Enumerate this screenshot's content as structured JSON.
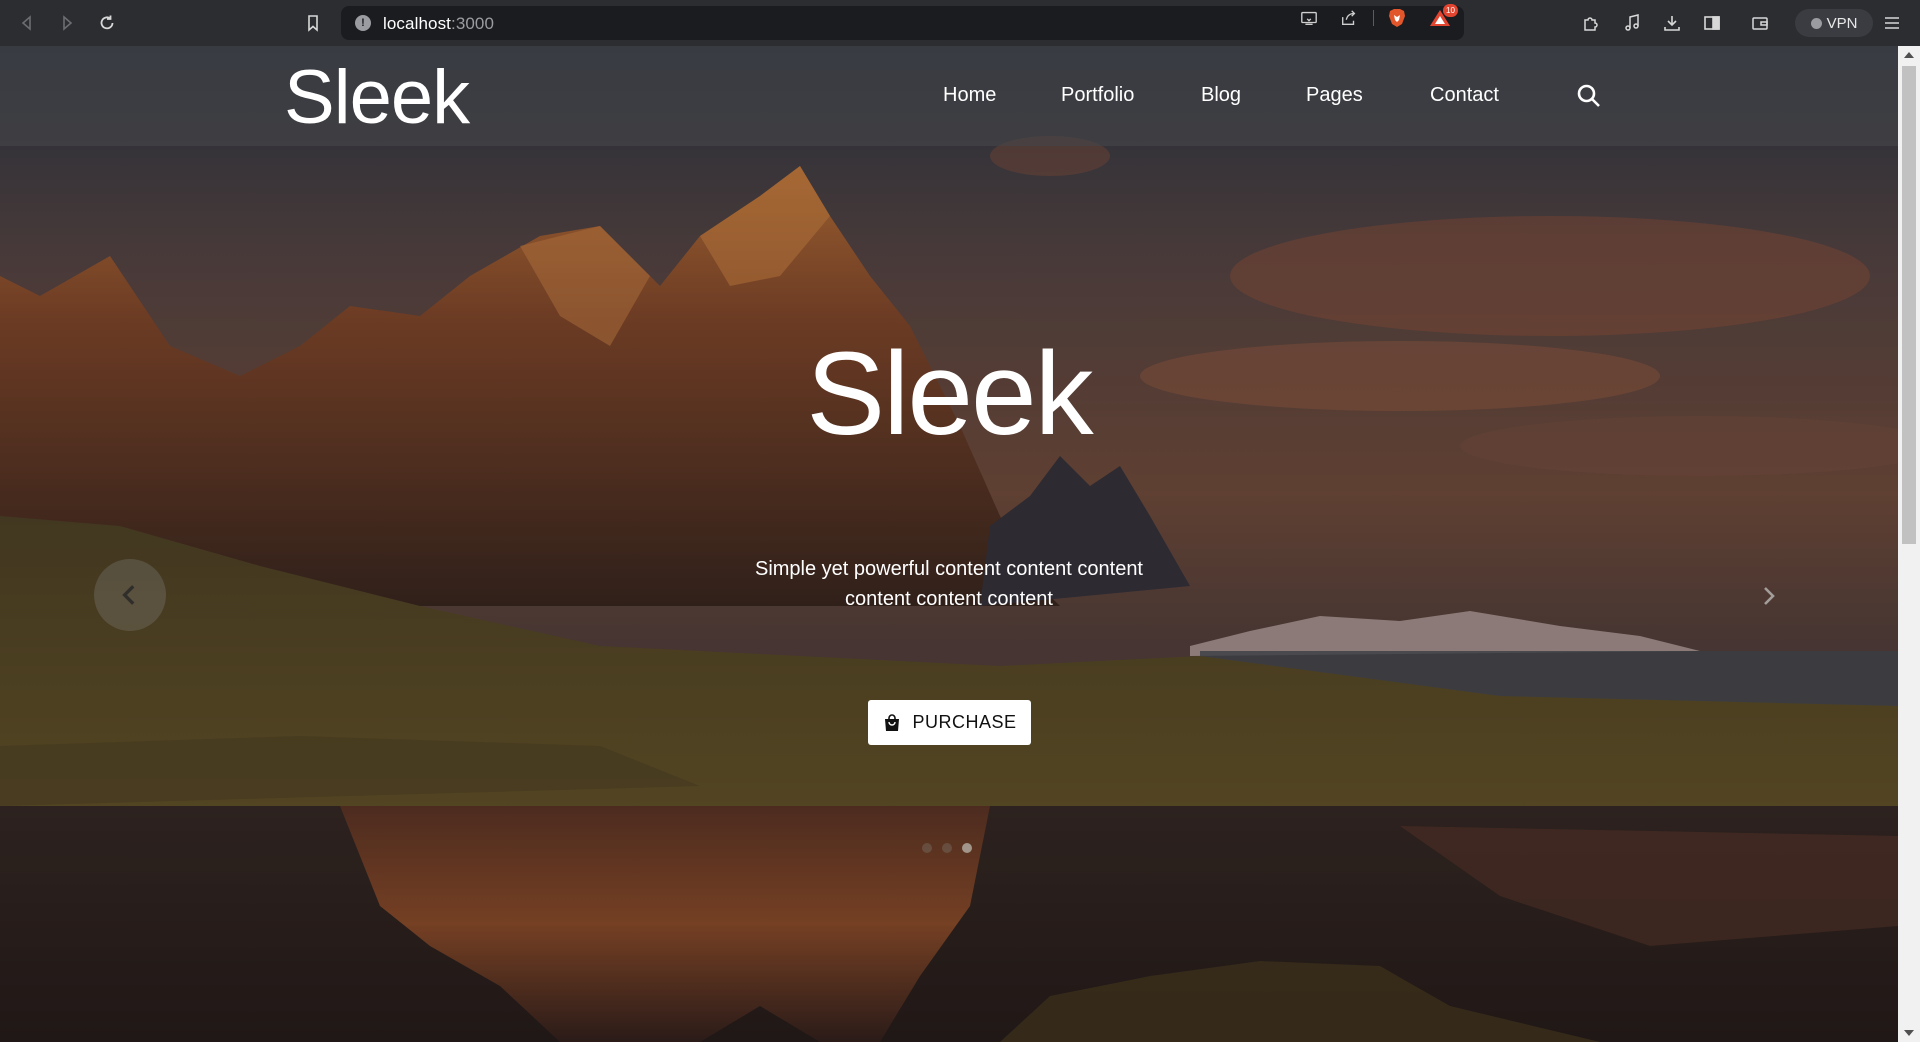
{
  "browser": {
    "url_host": "localhost",
    "url_port": ":3000",
    "notification_count": "10",
    "vpn_label": "VPN"
  },
  "nav": {
    "logo": "Sleek",
    "links": [
      "Home",
      "Portfolio",
      "Blog",
      "Pages",
      "Contact"
    ]
  },
  "hero": {
    "title": "Sleek",
    "subtitle": "Simple yet powerful content content content content content content",
    "button_label": "PURCHASE",
    "slide_count": 3,
    "active_slide": 3
  }
}
